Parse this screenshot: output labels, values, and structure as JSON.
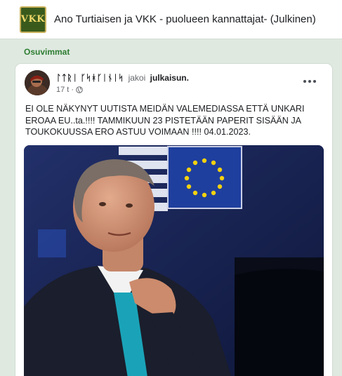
{
  "group": {
    "logo_text": "VKK",
    "title": "Ano Turtiaisen ja VKK - puolueen kannattajat- (Julkinen)"
  },
  "section": {
    "label": "Osuvimmat"
  },
  "post": {
    "author": "ᛚᛏᚱᛁ ᚴᛋᚼᚴᛁᚾᛁᛋ",
    "verb": "jakoi",
    "object": "julkaisun.",
    "time": "17 t",
    "dot": "·",
    "text": "EI OLE NÄKYNYT UUTISTA MEIDÄN VALEMEDIASSA ETTÄ UNKARI EROAA EU..ta.!!!! TAMMIKUUN 23 PISTETÄÄN PAPERIT SISÄÄN JA TOUKOKUUSSA ERO ASTUU VOIMAAN !!!! 04.01.2023."
  },
  "icons": {
    "globe": "globe-icon",
    "more": "more-icon"
  },
  "colors": {
    "page_bg": "#dfe9e0",
    "section_label": "#2e7d32",
    "logo_bg": "#3a5a1c",
    "eu_blue": "#1f3f9e"
  }
}
